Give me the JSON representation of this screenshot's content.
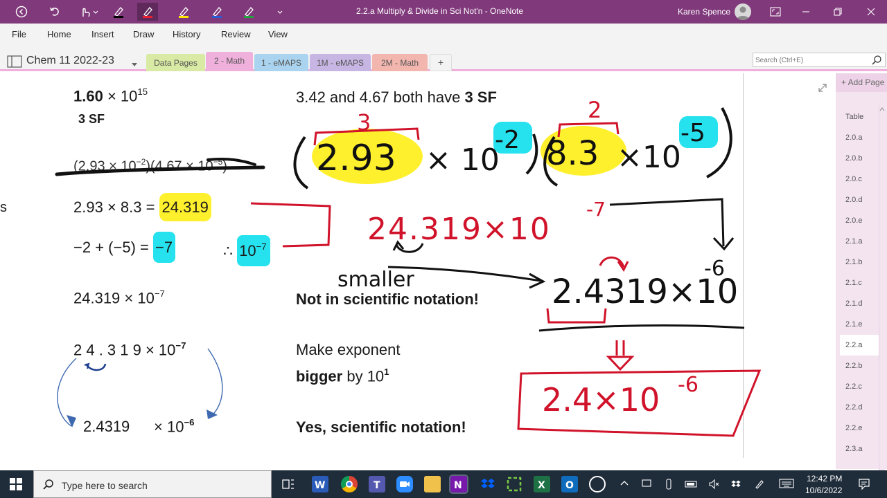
{
  "window": {
    "title": "2.2.a Multiply & Divide in Sci Not'n  -  OneNote",
    "user": "Karen Spence"
  },
  "menu": [
    "File",
    "Home",
    "Insert",
    "Draw",
    "History",
    "Review",
    "View"
  ],
  "notebook": {
    "name": "Chem 11 2022-23",
    "tabs": [
      {
        "label": "Data Pages",
        "color": "#d8eaa3"
      },
      {
        "label": "2 - Math",
        "color": "#efb0dc",
        "active": true
      },
      {
        "label": "1 - eMAPS",
        "color": "#a9d3ee"
      },
      {
        "label": "1M - eMAPS",
        "color": "#c7b6e3"
      },
      {
        "label": "2M - Math",
        "color": "#f3b6ae"
      },
      {
        "label": "+",
        "color": "#f3f3f3"
      }
    ],
    "search_placeholder": "Search (Ctrl+E)"
  },
  "page": {
    "left": {
      "n1_coef": "1.60",
      "n1_times": " × 10",
      "n1_exp": "15",
      "n1_sf": "3 SF",
      "strike_expr": "(2.93 × 10",
      "strike_exp1": "−2",
      "strike_mid": ")(4.67 × 10",
      "strike_exp2": "−5",
      "strike_end": ")",
      "edge_char": "s",
      "mult_expr": "2.93 × 8.3 = ",
      "mult_result": "24.319",
      "exp_expr": "−2 + (−5) = ",
      "exp_result": "−7",
      "therefore": "∴ ",
      "therefore_base": "10",
      "therefore_exp": "−7",
      "combined": "24.319 × 10",
      "combined_exp": "−7",
      "spaced": "2 4 . 3 1 9 × 10",
      "spaced_exp": "−7",
      "final_coef": "2.4319",
      "final_times": "× 10",
      "final_exp": "−6"
    },
    "right": {
      "sf_note_pre": "3.42 and 4.67 both have ",
      "sf_note_bold": "3 SF",
      "not_sci": "Not in scientific notation!",
      "make_exp": "Make exponent",
      "bigger": "bigger",
      "by": " by 10",
      "by_exp": "1",
      "yes_sci": "Yes, scientific notation!"
    },
    "ink_text": {
      "hw_293": "2.93",
      "hw_83": "8.3",
      "hw_neg2": "-2",
      "hw_neg5": "-5",
      "hw_sf3": "3",
      "hw_sf2": "2",
      "hw_24319": "24.319×10",
      "hw_neg7": "-7",
      "hw_smaller": "smaller",
      "hw_2_4319": "2.4319×10",
      "hw_neg6": "-6",
      "hw_answer": "2.4×10",
      "hw_answer_exp": "-6"
    }
  },
  "pages_panel": {
    "add_label": "+ Add Page",
    "items": [
      "Table",
      "2.0.a",
      "2.0.b",
      "2.0.c",
      "2.0.d",
      "2.0.e",
      "2.1.a",
      "2.1.b",
      "2.1.c",
      "2.1.d",
      "2.1.e",
      "2.2.a",
      "2.2.b",
      "2.2.c",
      "2.2.d",
      "2.2.e",
      "2.3.a"
    ],
    "active": "2.2.a"
  },
  "taskbar": {
    "search_text": "Type here to search",
    "time": "12:42 PM",
    "date": "10/6/2022"
  },
  "colors": {
    "title_bar": "#80397b",
    "highlight_yellow": "#fff02d",
    "highlight_cyan": "#25e2ee",
    "ink_red": "#d0132a",
    "ink_black": "#111111"
  }
}
